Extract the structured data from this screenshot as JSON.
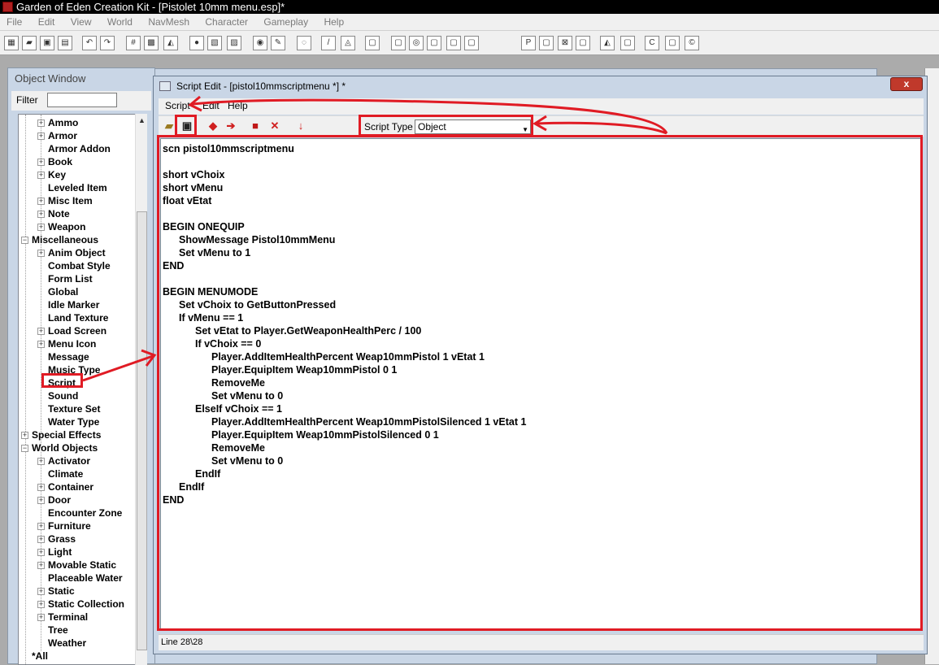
{
  "app": {
    "title": "Garden of Eden Creation Kit - [Pistolet 10mm menu.esp]*",
    "menus": [
      "File",
      "Edit",
      "View",
      "World",
      "NavMesh",
      "Character",
      "Gameplay",
      "Help"
    ]
  },
  "object_window": {
    "title": "Object Window",
    "filter_label": "Filter",
    "filter_value": "",
    "tree": [
      {
        "label": "Ammo",
        "level": 1,
        "expander": "+"
      },
      {
        "label": "Armor",
        "level": 1,
        "expander": "+"
      },
      {
        "label": "Armor Addon",
        "level": 1,
        "expander": ""
      },
      {
        "label": "Book",
        "level": 1,
        "expander": "+"
      },
      {
        "label": "Key",
        "level": 1,
        "expander": "+"
      },
      {
        "label": "Leveled Item",
        "level": 1,
        "expander": ""
      },
      {
        "label": "Misc Item",
        "level": 1,
        "expander": "+"
      },
      {
        "label": "Note",
        "level": 1,
        "expander": "+"
      },
      {
        "label": "Weapon",
        "level": 1,
        "expander": "+"
      },
      {
        "label": "Miscellaneous",
        "level": 0,
        "expander": "-"
      },
      {
        "label": "Anim Object",
        "level": 1,
        "expander": "+"
      },
      {
        "label": "Combat Style",
        "level": 1,
        "expander": ""
      },
      {
        "label": "Form List",
        "level": 1,
        "expander": ""
      },
      {
        "label": "Global",
        "level": 1,
        "expander": ""
      },
      {
        "label": "Idle Marker",
        "level": 1,
        "expander": ""
      },
      {
        "label": "Land Texture",
        "level": 1,
        "expander": ""
      },
      {
        "label": "Load Screen",
        "level": 1,
        "expander": "+"
      },
      {
        "label": "Menu Icon",
        "level": 1,
        "expander": "+"
      },
      {
        "label": "Message",
        "level": 1,
        "expander": ""
      },
      {
        "label": "Music Type",
        "level": 1,
        "expander": ""
      },
      {
        "label": "Script",
        "level": 1,
        "expander": ""
      },
      {
        "label": "Sound",
        "level": 1,
        "expander": ""
      },
      {
        "label": "Texture Set",
        "level": 1,
        "expander": ""
      },
      {
        "label": "Water Type",
        "level": 1,
        "expander": ""
      },
      {
        "label": "Special Effects",
        "level": 0,
        "expander": "+"
      },
      {
        "label": "World Objects",
        "level": 0,
        "expander": "-"
      },
      {
        "label": "Activator",
        "level": 1,
        "expander": "+"
      },
      {
        "label": "Climate",
        "level": 1,
        "expander": ""
      },
      {
        "label": "Container",
        "level": 1,
        "expander": "+"
      },
      {
        "label": "Door",
        "level": 1,
        "expander": "+"
      },
      {
        "label": "Encounter Zone",
        "level": 1,
        "expander": ""
      },
      {
        "label": "Furniture",
        "level": 1,
        "expander": "+"
      },
      {
        "label": "Grass",
        "level": 1,
        "expander": "+"
      },
      {
        "label": "Light",
        "level": 1,
        "expander": "+"
      },
      {
        "label": "Movable Static",
        "level": 1,
        "expander": "+"
      },
      {
        "label": "Placeable Water",
        "level": 1,
        "expander": ""
      },
      {
        "label": "Static",
        "level": 1,
        "expander": "+"
      },
      {
        "label": "Static Collection",
        "level": 1,
        "expander": "+"
      },
      {
        "label": "Terminal",
        "level": 1,
        "expander": "+"
      },
      {
        "label": "Tree",
        "level": 1,
        "expander": ""
      },
      {
        "label": "Weather",
        "level": 1,
        "expander": ""
      },
      {
        "label": "*All",
        "level": 0,
        "expander": ""
      }
    ]
  },
  "script_edit": {
    "title": "Script Edit - [pistol10mmscriptmenu *] *",
    "close_label": "x",
    "menus": [
      "Script",
      "Edit",
      "Help"
    ],
    "script_type_label": "Script Type",
    "script_type_value": "Object",
    "status": "Line 28\\28",
    "code_lines": [
      {
        "text": "scn pistol10mmscriptmenu",
        "indent": 0
      },
      {
        "text": "",
        "indent": 0
      },
      {
        "text": "short vChoix",
        "indent": 0
      },
      {
        "text": "short vMenu",
        "indent": 0
      },
      {
        "text": "float vEtat",
        "indent": 0
      },
      {
        "text": "",
        "indent": 0
      },
      {
        "text": "BEGIN ONEQUIP",
        "indent": 0
      },
      {
        "text": "ShowMessage Pistol10mmMenu",
        "indent": 1
      },
      {
        "text": "Set vMenu to 1",
        "indent": 1
      },
      {
        "text": "END",
        "indent": 0
      },
      {
        "text": "",
        "indent": 0
      },
      {
        "text": "BEGIN MENUMODE",
        "indent": 0
      },
      {
        "text": "Set vChoix to GetButtonPressed",
        "indent": 1
      },
      {
        "text": "If vMenu == 1",
        "indent": 1
      },
      {
        "text": "Set vEtat to Player.GetWeaponHealthPerc / 100",
        "indent": 2
      },
      {
        "text": "If vChoix == 0",
        "indent": 2
      },
      {
        "text": "Player.AddItemHealthPercent Weap10mmPistol 1 vEtat 1",
        "indent": 3
      },
      {
        "text": "Player.EquipItem Weap10mmPistol 0 1",
        "indent": 3
      },
      {
        "text": "RemoveMe",
        "indent": 3
      },
      {
        "text": "Set vMenu to 0",
        "indent": 3
      },
      {
        "text": "ElseIf vChoix == 1",
        "indent": 2
      },
      {
        "text": "Player.AddItemHealthPercent Weap10mmPistolSilenced 1 vEtat 1",
        "indent": 3
      },
      {
        "text": "Player.EquipItem Weap10mmPistolSilenced 0 1",
        "indent": 3
      },
      {
        "text": "RemoveMe",
        "indent": 3
      },
      {
        "text": "Set vMenu to 0",
        "indent": 3
      },
      {
        "text": "EndIf",
        "indent": 2
      },
      {
        "text": "EndIf",
        "indent": 1
      },
      {
        "text": "END",
        "indent": 0
      }
    ]
  },
  "colors": {
    "annotation": "#e01b24",
    "titlebar": "#000000",
    "window_frame": "#c9d6e6"
  }
}
